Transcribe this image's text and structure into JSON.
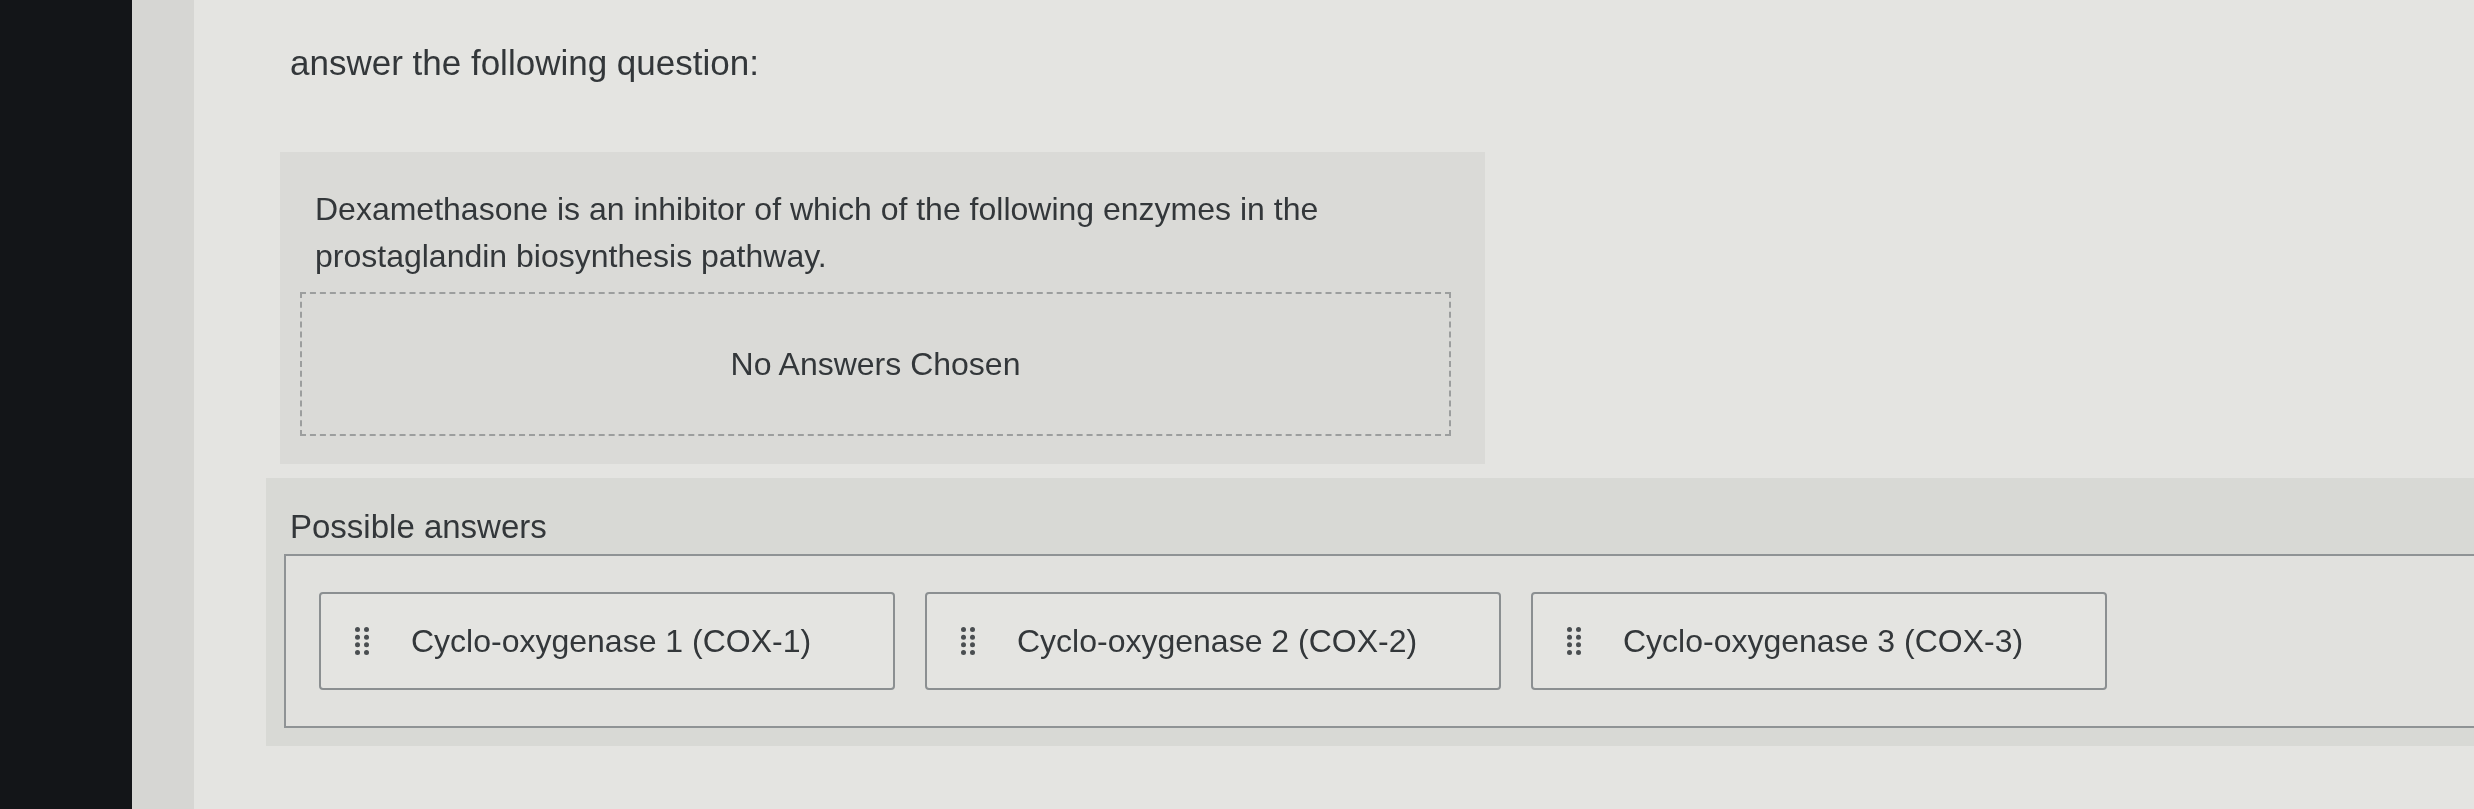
{
  "prompt": "answer the following question:",
  "question": {
    "text": "Dexamethasone is an inhibitor of which of the following enzymes in the prostaglandin biosynthesis pathway.",
    "drop_zone": {
      "empty_message": "No Answers Chosen"
    }
  },
  "possible_answers": {
    "title": "Possible answers",
    "answers": [
      {
        "label": "Cyclo-oxygenase 1 (COX-1)"
      },
      {
        "label": "Cyclo-oxygenase 2 (COX-2)"
      },
      {
        "label": "Cyclo-oxygenase 3 (COX-3)"
      }
    ]
  }
}
